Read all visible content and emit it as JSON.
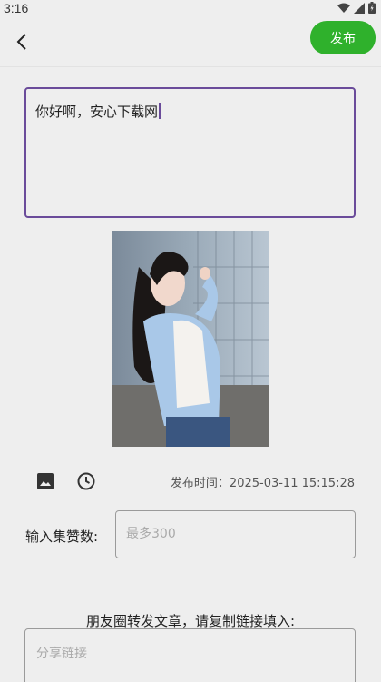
{
  "status_bar": {
    "time": "3:16"
  },
  "toolbar": {
    "publish_label": "发布"
  },
  "post": {
    "text": "你好啊，安心下载网"
  },
  "tools": {
    "image_icon": "image-icon",
    "clock_icon": "clock-icon"
  },
  "publish_time": "发布时间：2025-03-11 15:15:28",
  "likes": {
    "label": "输入集赞数:",
    "placeholder": "最多300"
  },
  "share": {
    "label": "朋友圈转发文章，请复制链接填入:",
    "placeholder": "分享链接"
  },
  "colors": {
    "accent": "#2fb12c",
    "focus_border": "#6a4b9a"
  }
}
